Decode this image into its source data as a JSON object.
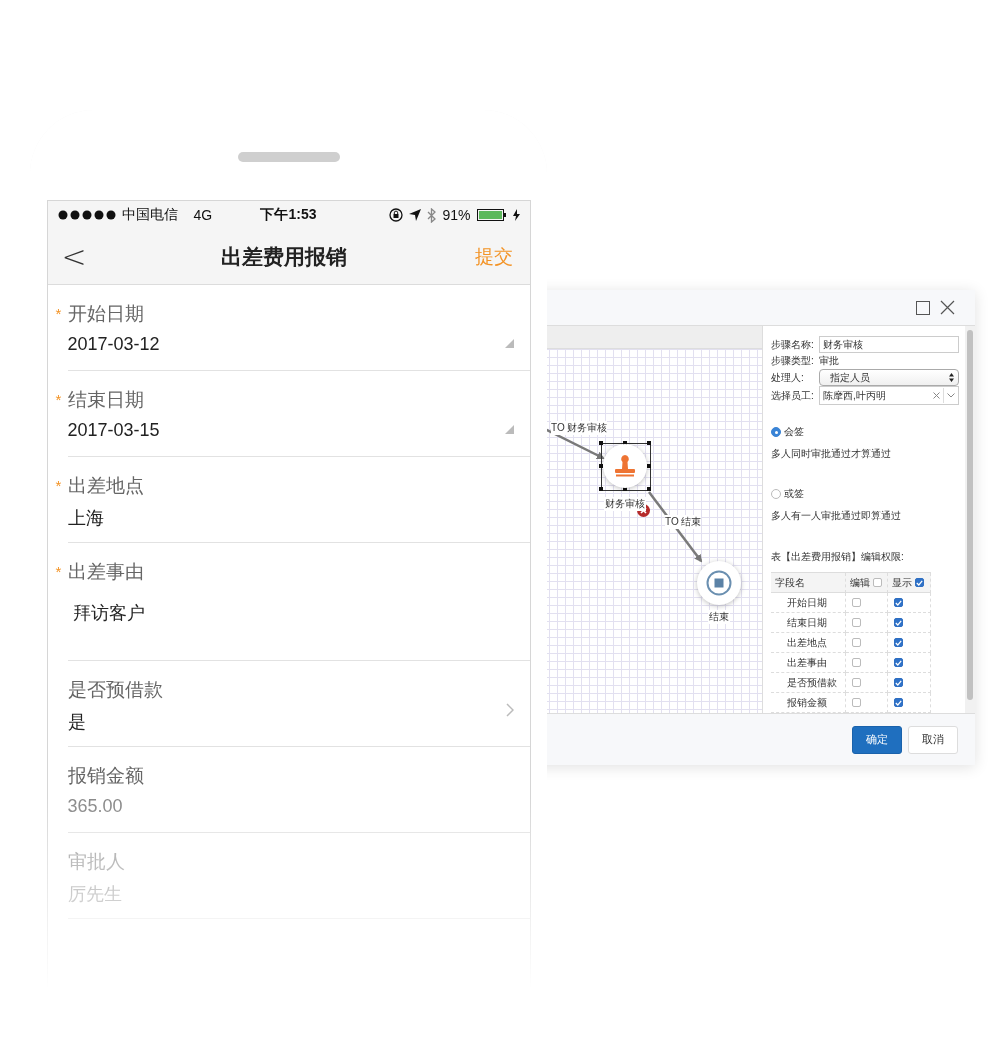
{
  "phone": {
    "status_bar": {
      "carrier": "中国电信",
      "network": "4G",
      "time": "下午1:53",
      "battery": "91%"
    },
    "nav": {
      "back": "<",
      "title": "出差费用报销",
      "action": "提交"
    },
    "fields": [
      {
        "label": "开始日期",
        "value": "2017-03-12",
        "required_mark": "*",
        "kind": "date"
      },
      {
        "label": "结束日期",
        "value": "2017-03-15",
        "required_mark": "*",
        "kind": "date"
      },
      {
        "label": "出差地点",
        "value": "上海",
        "required_mark": "*",
        "kind": "text"
      },
      {
        "label": "出差事由",
        "value": "拜访客户",
        "required_mark": "*",
        "kind": "textarea"
      },
      {
        "label": "是否预借款",
        "value": "是",
        "kind": "select"
      },
      {
        "label": "报销金额",
        "value": "365.00",
        "kind": "readonly"
      },
      {
        "label": "审批人",
        "value": "厉先生",
        "kind": "readonly"
      }
    ]
  },
  "dialog": {
    "canvas": {
      "nodes": [
        {
          "kind": "task",
          "label": "财务审核",
          "selected": true
        },
        {
          "kind": "end",
          "label": "结束",
          "selected": false
        }
      ],
      "edges": [
        {
          "label": "TO 财务审核"
        },
        {
          "label": "TO 结束"
        }
      ]
    },
    "properties": {
      "step_name": {
        "label": "步骤名称:",
        "value": "财务审核"
      },
      "step_type": {
        "label": "步骤类型:",
        "value": "审批"
      },
      "handler": {
        "label": "处理人:",
        "value": "指定人员"
      },
      "staff": {
        "label": "选择员工:",
        "value": "陈摩西,叶丙明"
      },
      "sign_modes": [
        {
          "label": "会签",
          "description": "多人同时审批通过才算通过",
          "selected": true
        },
        {
          "label": "或签",
          "description": "多人有一人审批通过即算通过",
          "selected": false
        }
      ],
      "permissions": {
        "caption": "表【出差费用报销】编辑权限:",
        "columns": [
          {
            "label": "字段名"
          },
          {
            "label": "编辑",
            "checked": false
          },
          {
            "label": "显示",
            "checked": true
          }
        ],
        "rows": [
          {
            "field": "开始日期",
            "edit": false,
            "show": true
          },
          {
            "field": "结束日期",
            "edit": false,
            "show": true
          },
          {
            "field": "出差地点",
            "edit": false,
            "show": true
          },
          {
            "field": "出差事由",
            "edit": false,
            "show": true
          },
          {
            "field": "是否预借款",
            "edit": false,
            "show": true
          },
          {
            "field": "报销金额",
            "edit": false,
            "show": true
          }
        ]
      }
    },
    "buttons": [
      {
        "label": "确定",
        "kind": "primary"
      },
      {
        "label": "取消",
        "kind": "default"
      }
    ]
  }
}
